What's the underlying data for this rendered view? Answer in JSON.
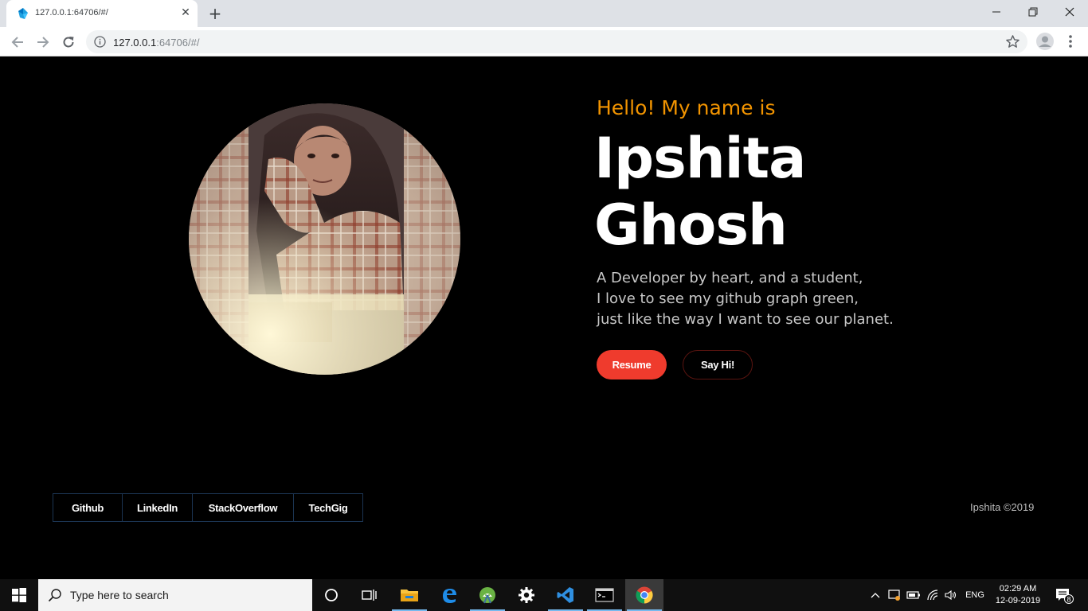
{
  "browser": {
    "tab_title": "127.0.0.1:64706/#/",
    "url_host": "127.0.0.1",
    "url_rest": ":64706/#/"
  },
  "hero": {
    "greeting": "Hello! My name is",
    "first_name": "Ipshita",
    "last_name": "Ghosh",
    "bio_lines": [
      "A Developer by heart, and a student,",
      "I love to see my github graph green,",
      "just like the way I want to see our planet."
    ],
    "resume_label": "Resume",
    "say_hi_label": "Say Hi!"
  },
  "footer": {
    "links": [
      {
        "label": "Github"
      },
      {
        "label": "LinkedIn"
      },
      {
        "label": "StackOverflow"
      },
      {
        "label": "TechGig"
      }
    ],
    "copyright": "Ipshita ©2019"
  },
  "taskbar": {
    "search_placeholder": "Type here to search",
    "language": "ENG",
    "time": "02:29 AM",
    "date": "12-09-2019",
    "notification_count": "8"
  },
  "colors": {
    "greeting": "#f29400",
    "resume_button": "#ef3b2d",
    "say_hi_border": "#5a1410",
    "social_border": "#1b3452"
  }
}
